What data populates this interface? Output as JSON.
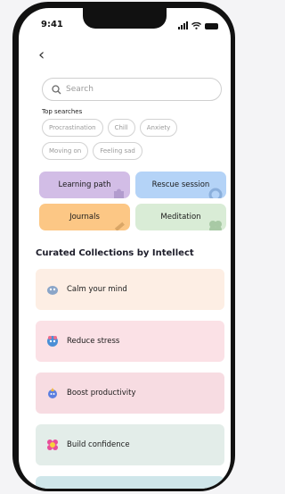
{
  "status": {
    "time": "9:41"
  },
  "search": {
    "placeholder": "Search"
  },
  "top_searches": {
    "title": "Top searches",
    "chips": [
      "Procrastination",
      "Chill",
      "Anxiety",
      "Moving on",
      "Feeling sad"
    ]
  },
  "tiles": [
    "Learning path",
    "Rescue session",
    "Journals",
    "Meditation"
  ],
  "collections": {
    "heading": "Curated Collections by Intellect",
    "cards": [
      "Calm your mind",
      "Reduce stress",
      "Boost productivity",
      "Build confidence",
      ""
    ]
  },
  "colors": {
    "learning_path": "#d2bde6",
    "rescue_session": "#b4d3f7",
    "journals": "#fcc785",
    "meditation": "#d9ecd6",
    "card_calm": "#fdeee4",
    "card_stress": "#fbe1e6",
    "card_productivity": "#f7dce2",
    "card_confidence": "#e3ede9",
    "card_next": "#cfe6ea"
  },
  "icons": [
    "back-chevron-icon",
    "search-icon",
    "signal-icon",
    "wifi-icon",
    "battery-icon"
  ]
}
